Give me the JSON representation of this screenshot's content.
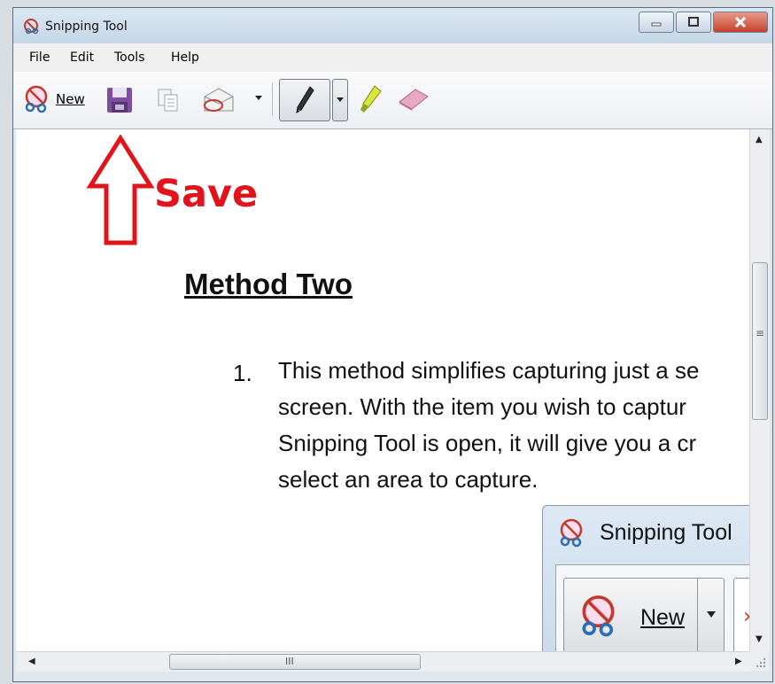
{
  "window": {
    "title": "Snipping Tool",
    "controls": {
      "minimize": "minimize",
      "maximize": "maximize",
      "close": "close"
    }
  },
  "menu": [
    "File",
    "Edit",
    "Tools",
    "Help"
  ],
  "toolbar": {
    "new_label": "New",
    "icons": [
      "scissors-icon",
      "save-icon",
      "copy-icon",
      "send-icon",
      "pen-icon",
      "highlighter-icon",
      "eraser-icon"
    ]
  },
  "annotation": {
    "label": "Save",
    "color": "#e0141a"
  },
  "document": {
    "heading": "Method Two",
    "list_number": "1.",
    "lines": [
      "This method simplifies capturing just a se",
      "screen. With the item you wish to captur",
      "Snipping Tool is open, it will give you a cr",
      "select an area to capture."
    ]
  },
  "embedded_window": {
    "title": "Snipping Tool",
    "new_label": "New"
  },
  "scrollbar": {
    "h_thumb_grip": "III",
    "v_thumb_grip": "≡"
  }
}
